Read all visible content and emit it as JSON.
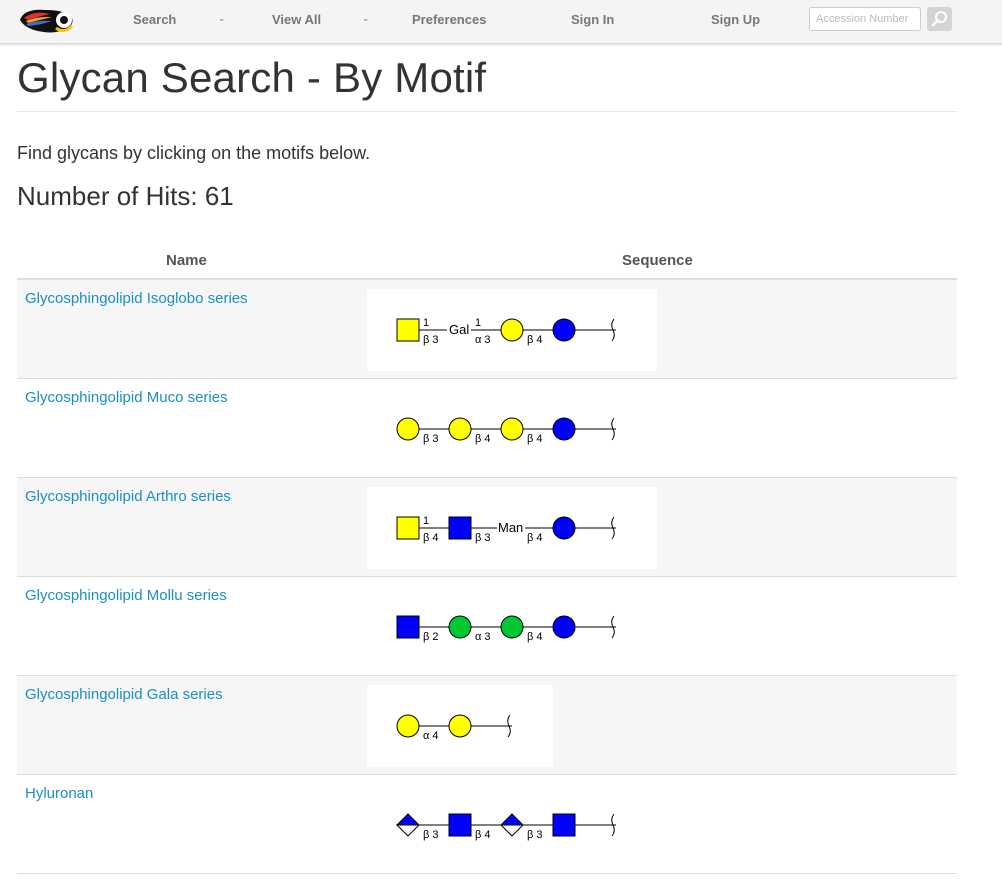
{
  "nav": {
    "search": "Search",
    "view_all": "View All",
    "preferences": "Preferences",
    "sign_in": "Sign In",
    "sign_up": "Sign Up",
    "accession_placeholder": "Accession Number"
  },
  "page": {
    "title": "Glycan Search - By Motif",
    "intro": "Find glycans by clicking on the motifs below.",
    "hits": "Number of Hits: 61"
  },
  "table": {
    "columns": [
      "Name",
      "Sequence"
    ],
    "rows": [
      {
        "name": "Glycosphingolipid Isoglobo series",
        "sequence": [
          "Gal-square",
          "β1-3",
          "Gal",
          "α1-3",
          "Gal",
          "β4",
          "Glc",
          "reducing-end"
        ]
      },
      {
        "name": "Glycosphingolipid Muco series",
        "sequence": [
          "Gal",
          "β3",
          "Gal",
          "β4",
          "Gal",
          "β4",
          "Glc",
          "reducing-end"
        ]
      },
      {
        "name": "Glycosphingolipid Arthro series",
        "sequence": [
          "GalNAc-yellow",
          "β1-4",
          "GlcNAc",
          "β3",
          "Man",
          "β4",
          "Glc",
          "reducing-end"
        ]
      },
      {
        "name": "Glycosphingolipid Mollu series",
        "sequence": [
          "GlcNAc",
          "β2",
          "Man",
          "α3",
          "Man",
          "β4",
          "Glc",
          "reducing-end"
        ]
      },
      {
        "name": "Glycosphingolipid Gala series",
        "sequence": [
          "Gal",
          "α4",
          "Gal",
          "reducing-end"
        ]
      },
      {
        "name": "Hyluronan",
        "sequence": [
          "GlcA",
          "β3",
          "GlcNAc",
          "β4",
          "GlcA",
          "β3",
          "GlcNAc",
          "reducing-end"
        ]
      }
    ]
  },
  "labels": {
    "one": "1",
    "b3": "β 3",
    "b4": "β 4",
    "b2": "β 2",
    "a3": "α 3",
    "a4": "α 4",
    "gal": "Gal",
    "man": "Man"
  },
  "colors": {
    "link": "#1a8fc4",
    "glc_blue": "#0000ff",
    "gal_yellow": "#ffff00",
    "man_green": "#00c832"
  }
}
